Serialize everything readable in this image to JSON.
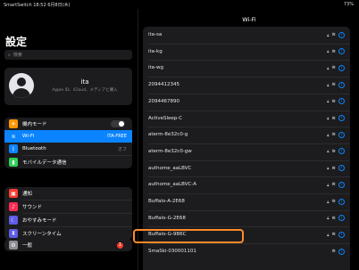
{
  "status": {
    "left": "SmartSwitch 18:52 6月8日(木)",
    "right": "73%"
  },
  "sidebar": {
    "title": "設定",
    "search_placeholder": "検索",
    "profile": {
      "name": "ita",
      "subtitle": "Apple ID、iCloud、メディアと購入"
    },
    "group1": [
      {
        "label": "機内モード",
        "icon": "airplane-icon",
        "color": "#ff9500"
      },
      {
        "label": "Wi-Fi",
        "value": "ITA-FREE",
        "icon": "wifi-icon",
        "color": "#0a84ff"
      },
      {
        "label": "Bluetooth",
        "value": "オフ",
        "icon": "bluetooth-icon",
        "color": "#0a84ff"
      },
      {
        "label": "モバイルデータ通信",
        "icon": "cellular-icon",
        "color": "#30d158"
      }
    ],
    "group2": [
      {
        "label": "通知",
        "icon": "notifications-icon",
        "color": "#ff3b30"
      },
      {
        "label": "サウンド",
        "icon": "sound-icon",
        "color": "#ff2d55"
      },
      {
        "label": "おやすみモード",
        "icon": "moon-icon",
        "color": "#5e5ce6"
      },
      {
        "label": "スクリーンタイム",
        "icon": "hourglass-icon",
        "color": "#5e5ce6"
      }
    ],
    "group3": [
      {
        "label": "一般",
        "icon": "gear-icon",
        "color": "#8e8e93",
        "badge": "1"
      }
    ]
  },
  "wifi": {
    "title": "Wi-Fi",
    "networks": [
      "ita-sa",
      "ita-kg",
      "ita-wg",
      "2094412345",
      "2094467890",
      "ActiveSleep-C",
      "aterm-8e32c0-g",
      "aterm-8e32c0-gw",
      "authome_aaLBVC",
      "authome_aaLBVC-A",
      "Buffalo-A-2E68",
      "Buffalo-G-2E68",
      "Buffalo-G-9B6C",
      "SmaSki-030001101"
    ]
  }
}
